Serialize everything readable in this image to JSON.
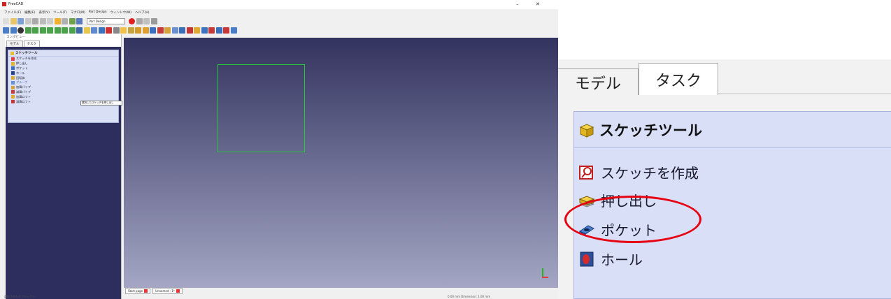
{
  "app": {
    "title": "FreeCAD",
    "window_buttons": {
      "minimize": "–",
      "maximize": "▫",
      "close": "✕"
    },
    "menus": [
      "ファイル(F)",
      "編集(E)",
      "表示(V)",
      "ツール(T)",
      "マクロ(M)",
      "Part Design",
      "ウィンドウ(W)",
      "ヘルプ(H)"
    ],
    "workbench": "Part Design",
    "combo_view_title": "コンボビュー",
    "combo_tabs": [
      "モデル",
      "タスク"
    ],
    "task_panel": {
      "header": "スケッチツール",
      "items": [
        "スケッチを作成",
        "押し出し",
        "ポケット",
        "ホール",
        "回転体",
        "グルーブ",
        "加算パイプ",
        "減算パイプ",
        "加算ロフト",
        "減算ロフト"
      ]
    },
    "tooltip": "選択したスケッチを押し出し",
    "doc_tabs": [
      "Start page",
      "Unnamed : 1*"
    ],
    "status_left": "選択されたオブジェクト",
    "status_right": "0.00 mm  Dimension: 1.00 mm"
  },
  "zoom": {
    "tabs": [
      "モデル",
      "タスク"
    ],
    "header": "スケッチツール",
    "items": [
      "スケッチを作成",
      "押し出し",
      "ポケット",
      "ホール"
    ],
    "highlighted_item": "押し出し"
  },
  "colors": {
    "viewport_top": "#33335f",
    "viewport_bottom": "#a4a6c4",
    "sketch_line": "#1fcf32",
    "highlight": "#e60012",
    "task_bg": "#d8dff7"
  }
}
